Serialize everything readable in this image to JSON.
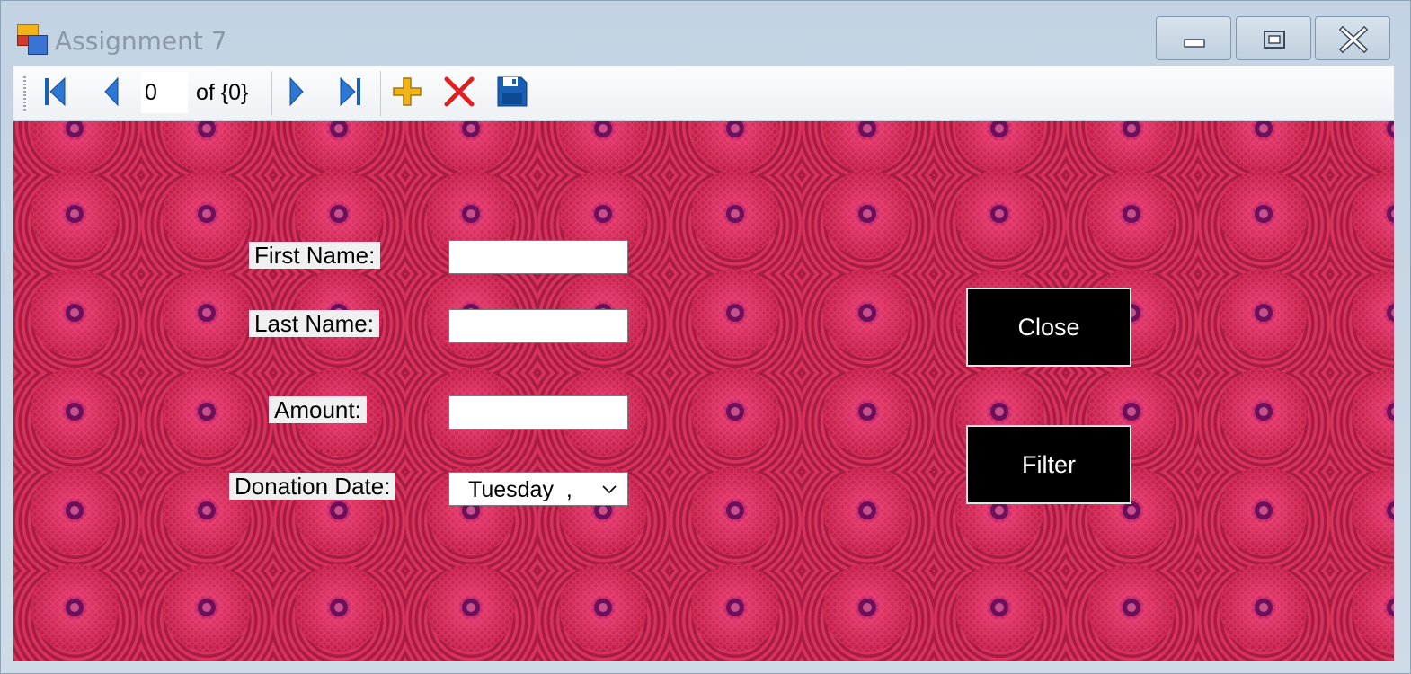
{
  "window": {
    "title": "Assignment 7",
    "controls": [
      "minimize",
      "maximize",
      "close"
    ]
  },
  "toolbar": {
    "position_value": "0",
    "count_label": "of {0}",
    "buttons": [
      {
        "name": "move-first",
        "icon": "first-record-icon"
      },
      {
        "name": "move-previous",
        "icon": "previous-record-icon"
      },
      {
        "name": "move-next",
        "icon": "next-record-icon"
      },
      {
        "name": "move-last",
        "icon": "last-record-icon"
      },
      {
        "name": "add-new",
        "icon": "add-icon"
      },
      {
        "name": "delete",
        "icon": "delete-icon"
      },
      {
        "name": "save",
        "icon": "save-icon"
      }
    ]
  },
  "form": {
    "first_name_label": "First Name:",
    "last_name_label": "Last Name:",
    "amount_label": "Amount:",
    "donation_date_label": "Donation Date:",
    "first_name_value": "",
    "last_name_value": "",
    "amount_value": "",
    "donation_date_value": "Tuesday  ,"
  },
  "buttons": {
    "close_label": "Close",
    "filter_label": "Filter"
  },
  "colors": {
    "background": "#000000",
    "flower": "#c5245a",
    "toolbar_icon_blue": "#1a5fb4",
    "add_icon": "#f0b418",
    "delete_icon": "#e02020"
  }
}
